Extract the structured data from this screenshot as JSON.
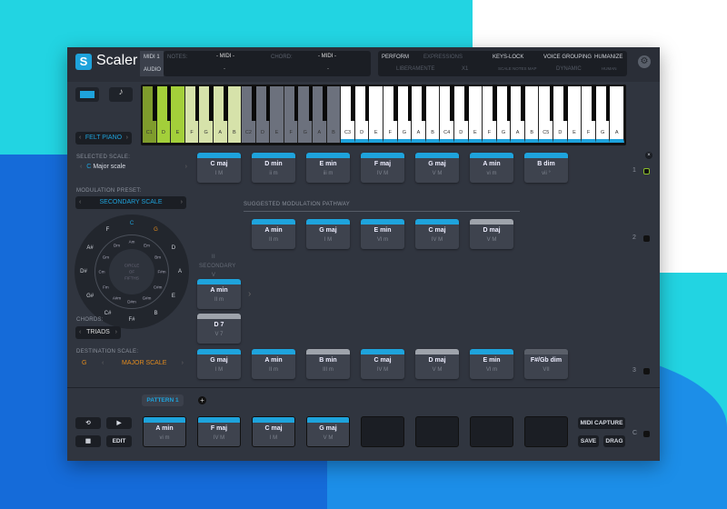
{
  "app": {
    "title": "Scaler",
    "logo_letter": "S"
  },
  "header": {
    "io": [
      "MIDI 1",
      "AUDIO"
    ],
    "notes_label": "NOTES:",
    "notes_value": "- MIDI -",
    "notes_sub": "-",
    "chord_label": "CHORD:",
    "chord_value": "- MIDI -",
    "chord_sub": "-",
    "perform": {
      "label": "PERFORM",
      "expressions": "EXPRESSIONS",
      "mode": "LIBERAMENTE",
      "rate": "X1"
    },
    "keys_lock": {
      "label": "KEYS-LOCK",
      "value": "SCALE NOTES MAP"
    },
    "voice_grouping": {
      "label": "VOICE GROUPING",
      "value": "DYNAMIC"
    },
    "humanize": {
      "label": "HUMANIZE",
      "value": "HUMAN"
    }
  },
  "keyboard": {
    "keys": [
      "C1",
      "D",
      "E",
      "F",
      "G",
      "A",
      "B",
      "C2",
      "D",
      "E",
      "F",
      "G",
      "A",
      "B",
      "C3",
      "D",
      "E",
      "F",
      "G",
      "A",
      "B",
      "C4",
      "D",
      "E",
      "F",
      "G",
      "A",
      "B",
      "C5",
      "D",
      "E",
      "F",
      "G",
      "A"
    ],
    "colors": {
      "root": "#7f9c2c",
      "active": "#a3cf3a",
      "scale": "#d6e2aa",
      "gray": "#6c717d",
      "white": "#ffffff",
      "blue": "#1ea3dc"
    }
  },
  "instrument": {
    "name": "FELT PIANO"
  },
  "left": {
    "selected_scale_label": "SELECTED SCALE:",
    "selected_root": "C",
    "selected_scale": "Major scale",
    "modulation_preset_label": "MODULATION PRESET:",
    "modulation_preset": "SECONDARY SCALE",
    "circle": {
      "outer": [
        "C",
        "G",
        "D",
        "A",
        "E",
        "B",
        "F#",
        "C#",
        "G#",
        "D#",
        "A#",
        "F"
      ],
      "inner": [
        "Am",
        "Em",
        "Bm",
        "F#m",
        "C#m",
        "G#m",
        "D#m",
        "A#m",
        "Fm",
        "Cm",
        "Gm",
        "Dm"
      ],
      "center": [
        "CIRCLE",
        "OF",
        "FIFTHS"
      ]
    },
    "chords_label": "CHORDS:",
    "chords_value": "TRIADS",
    "destination_label": "DESTINATION SCALE:",
    "destination_root": "G",
    "destination_scale": "MAJOR SCALE"
  },
  "row1": [
    {
      "n": "C maj",
      "r": "I M",
      "c": "b"
    },
    {
      "n": "D min",
      "r": "ii m",
      "c": "b"
    },
    {
      "n": "E min",
      "r": "iii m",
      "c": "b"
    },
    {
      "n": "F maj",
      "r": "IV M",
      "c": "b"
    },
    {
      "n": "G maj",
      "r": "V M",
      "c": "b"
    },
    {
      "n": "A min",
      "r": "vi m",
      "c": "b"
    },
    {
      "n": "B dim",
      "r": "vii °",
      "c": "b"
    }
  ],
  "pathway_label": "SUGGESTED MODULATION PATHWAY",
  "pathway": [
    {
      "n": "A min",
      "r": "II m",
      "c": "b"
    },
    {
      "n": "G maj",
      "r": "I M",
      "c": "b"
    },
    {
      "n": "E min",
      "r": "VI m",
      "c": "b"
    },
    {
      "n": "C maj",
      "r": "IV M",
      "c": "b"
    },
    {
      "n": "D maj",
      "r": "V M",
      "c": "g"
    }
  ],
  "secondary_label": [
    "II",
    "SECONDARY",
    "V"
  ],
  "secondary": [
    {
      "n": "A min",
      "r": "II m",
      "c": "b"
    },
    {
      "n": "D 7",
      "r": "V 7",
      "c": "g"
    }
  ],
  "row3": [
    {
      "n": "G maj",
      "r": "I M",
      "c": "b"
    },
    {
      "n": "A min",
      "r": "II m",
      "c": "b"
    },
    {
      "n": "B min",
      "r": "III m",
      "c": "g"
    },
    {
      "n": "C maj",
      "r": "IV M",
      "c": "b"
    },
    {
      "n": "D maj",
      "r": "V M",
      "c": "g"
    },
    {
      "n": "E min",
      "r": "VI m",
      "c": "b"
    },
    {
      "n": "F#/Gb dim",
      "r": "VII",
      "c": "dg"
    }
  ],
  "rows": [
    "1",
    "2",
    "3",
    "C"
  ],
  "pattern": {
    "tab": "PATTERN 1",
    "edit": "EDIT",
    "chords": [
      {
        "n": "A min",
        "r": "vi m"
      },
      {
        "n": "F maj",
        "r": "IV M"
      },
      {
        "n": "C maj",
        "r": "I M"
      },
      {
        "n": "G maj",
        "r": "V M"
      }
    ],
    "midi_capture": "MIDI CAPTURE",
    "save": "SAVE",
    "drag": "DRAG"
  }
}
